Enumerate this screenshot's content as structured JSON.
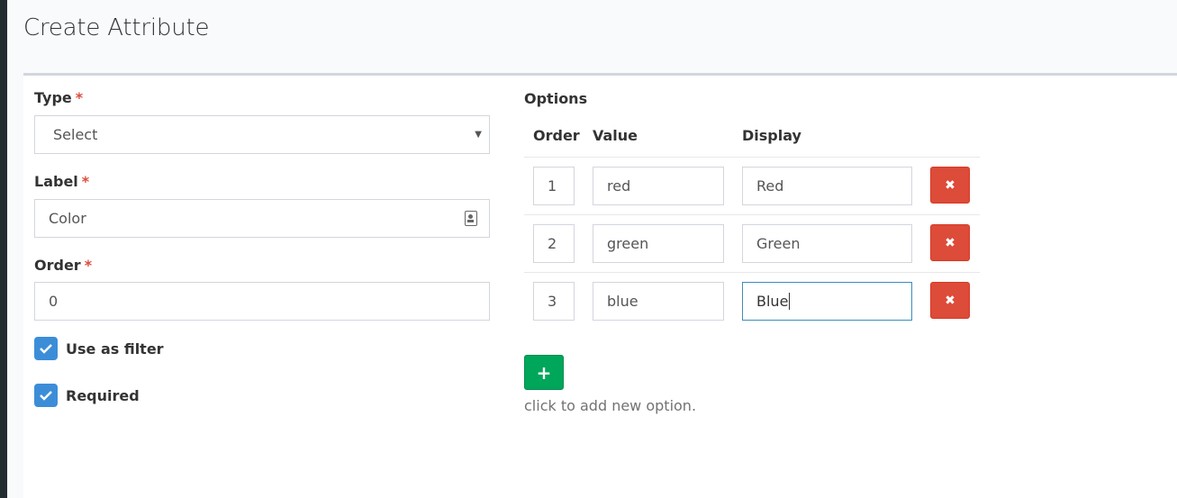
{
  "page": {
    "title": "Create Attribute"
  },
  "form": {
    "type": {
      "label": "Type",
      "required_mark": "*",
      "value": "Select"
    },
    "label": {
      "label": "Label",
      "required_mark": "*",
      "value": "Color"
    },
    "order": {
      "label": "Order",
      "required_mark": "*",
      "value": "0"
    },
    "use_as_filter": {
      "label": "Use as filter",
      "checked": true
    },
    "required": {
      "label": "Required",
      "checked": true
    }
  },
  "options": {
    "title": "Options",
    "headers": {
      "order": "Order",
      "value": "Value",
      "display": "Display"
    },
    "rows": [
      {
        "order": "1",
        "value": "red",
        "display": "Red"
      },
      {
        "order": "2",
        "value": "green",
        "display": "Green"
      },
      {
        "order": "3",
        "value": "blue",
        "display": "Blue"
      }
    ],
    "delete_symbol": "✖",
    "add_symbol": "+",
    "hint": "click to add new option."
  },
  "colors": {
    "danger": "#dd4b39",
    "success": "#00a65a",
    "checkbox": "#3c8dd8"
  }
}
